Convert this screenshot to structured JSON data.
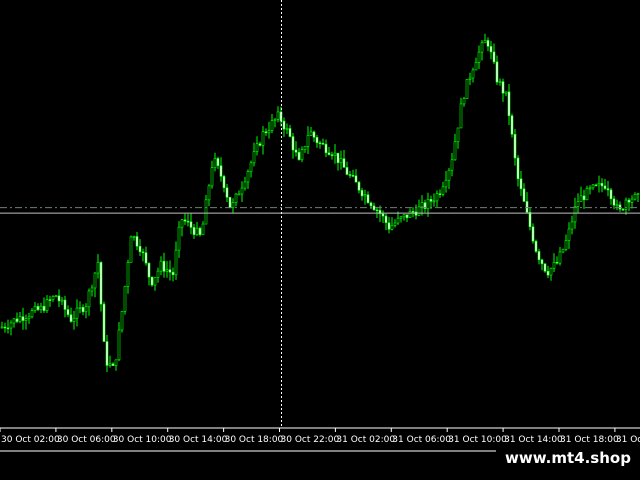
{
  "chart_data": {
    "type": "candlestick",
    "x_labels": [
      "30 Oct 02:00",
      "30 Oct 06:00",
      "30 Oct 10:00",
      "30 Oct 14:00",
      "30 Oct 18:00",
      "30 Oct 22:00",
      "31 Oct 02:00",
      "31 Oct 06:00",
      "31 Oct 10:00",
      "31 Oct 14:00",
      "31 Oct 18:00",
      "31 Oct"
    ],
    "ylim": [
      0,
      100
    ],
    "horizontal_level": 51.5,
    "crosshair": {
      "x_label": "30 Oct 22:00",
      "y": 50.2
    },
    "colors": {
      "background": "#000000",
      "candle_up": "#00ff00",
      "candle_down": "#00ff00",
      "candle_up_fill": "#000000",
      "candle_down_fill": "#ffffff",
      "grid_line": "#708070",
      "crosshair": "#ffffff"
    },
    "price_path": [
      [
        0,
        23.5
      ],
      [
        20,
        26
      ],
      [
        40,
        27.8
      ],
      [
        55,
        31
      ],
      [
        70,
        25.5
      ],
      [
        85,
        29
      ],
      [
        97,
        38.8
      ],
      [
        104,
        16
      ],
      [
        113,
        13.5
      ],
      [
        122,
        29
      ],
      [
        130,
        45.5
      ],
      [
        140,
        42
      ],
      [
        150,
        34
      ],
      [
        160,
        38
      ],
      [
        172,
        36
      ],
      [
        180,
        49
      ],
      [
        190,
        47
      ],
      [
        200,
        44.5
      ],
      [
        212,
        63
      ],
      [
        222,
        58
      ],
      [
        230,
        51
      ],
      [
        242,
        57.5
      ],
      [
        262,
        68.7
      ],
      [
        278,
        73
      ],
      [
        288,
        68.5
      ],
      [
        298,
        61.8
      ],
      [
        308,
        69.5
      ],
      [
        318,
        66.5
      ],
      [
        332,
        64.5
      ],
      [
        348,
        59
      ],
      [
        362,
        55
      ],
      [
        378,
        50.5
      ],
      [
        388,
        47
      ],
      [
        398,
        48.5
      ],
      [
        412,
        50.5
      ],
      [
        425,
        52
      ],
      [
        438,
        55
      ],
      [
        450,
        62
      ],
      [
        462,
        77.4
      ],
      [
        474,
        86
      ],
      [
        486,
        91
      ],
      [
        496,
        81.6
      ],
      [
        506,
        77
      ],
      [
        516,
        59
      ],
      [
        526,
        49.7
      ],
      [
        536,
        41
      ],
      [
        546,
        36.5
      ],
      [
        556,
        38.5
      ],
      [
        566,
        44
      ],
      [
        576,
        53
      ],
      [
        590,
        55.6
      ],
      [
        606,
        57.1
      ],
      [
        618,
        50
      ],
      [
        626,
        54
      ],
      [
        640,
        53.5
      ]
    ]
  }
}
